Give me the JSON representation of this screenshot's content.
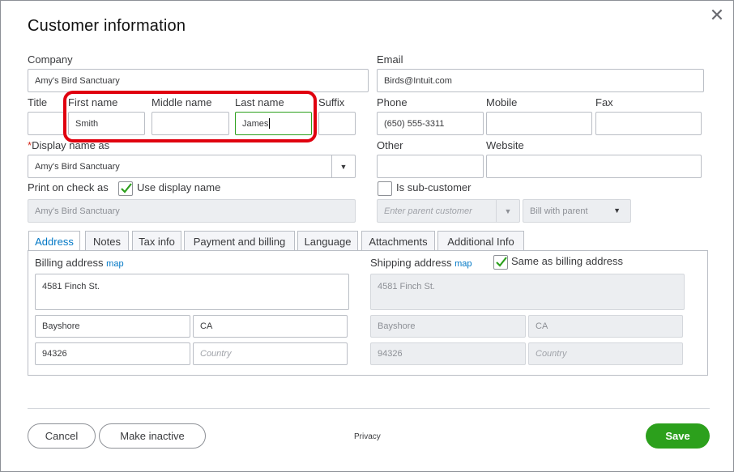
{
  "dialog": {
    "title": "Customer information",
    "close_icon": "close-icon"
  },
  "fields": {
    "company_label": "Company",
    "company_value": "Amy's Bird Sanctuary",
    "email_label": "Email",
    "email_value": "Birds@Intuit.com",
    "title_label": "Title",
    "first_name_label": "First name",
    "first_name_value": "Smith",
    "middle_name_label": "Middle name",
    "last_name_label": "Last name",
    "last_name_value": "James",
    "suffix_label": "Suffix",
    "phone_label": "Phone",
    "phone_value": "(650) 555-3311",
    "mobile_label": "Mobile",
    "fax_label": "Fax",
    "display_name_required": "*",
    "display_name_label": "Display name as",
    "display_name_value": "Amy's Bird Sanctuary",
    "other_label": "Other",
    "website_label": "Website",
    "print_on_check_label": "Print on check as",
    "use_display_name_label": "Use display name",
    "print_on_check_value": "Amy's Bird Sanctuary",
    "is_subcustomer_label": "Is sub-customer",
    "parent_customer_placeholder": "Enter parent customer",
    "bill_with_parent_value": "Bill with parent"
  },
  "tabs": [
    {
      "label": "Address",
      "active": true
    },
    {
      "label": "Notes"
    },
    {
      "label": "Tax info"
    },
    {
      "label": "Payment and billing"
    },
    {
      "label": "Language"
    },
    {
      "label": "Attachments"
    },
    {
      "label": "Additional Info"
    }
  ],
  "billing": {
    "label": "Billing address",
    "map_link": "map",
    "street": "4581 Finch St.",
    "city": "Bayshore",
    "state": "CA",
    "zip": "94326",
    "country_placeholder": "Country"
  },
  "shipping": {
    "label": "Shipping address",
    "map_link": "map",
    "same_as_billing_label": "Same as billing address",
    "street": "4581 Finch St.",
    "city": "Bayshore",
    "state": "CA",
    "zip": "94326",
    "country_placeholder": "Country"
  },
  "footer": {
    "cancel_label": "Cancel",
    "make_inactive_label": "Make inactive",
    "privacy_label": "Privacy",
    "save_label": "Save"
  },
  "colors": {
    "accent_green": "#2ca01c",
    "link_blue": "#0077c5",
    "highlight_red": "#e0000f"
  }
}
